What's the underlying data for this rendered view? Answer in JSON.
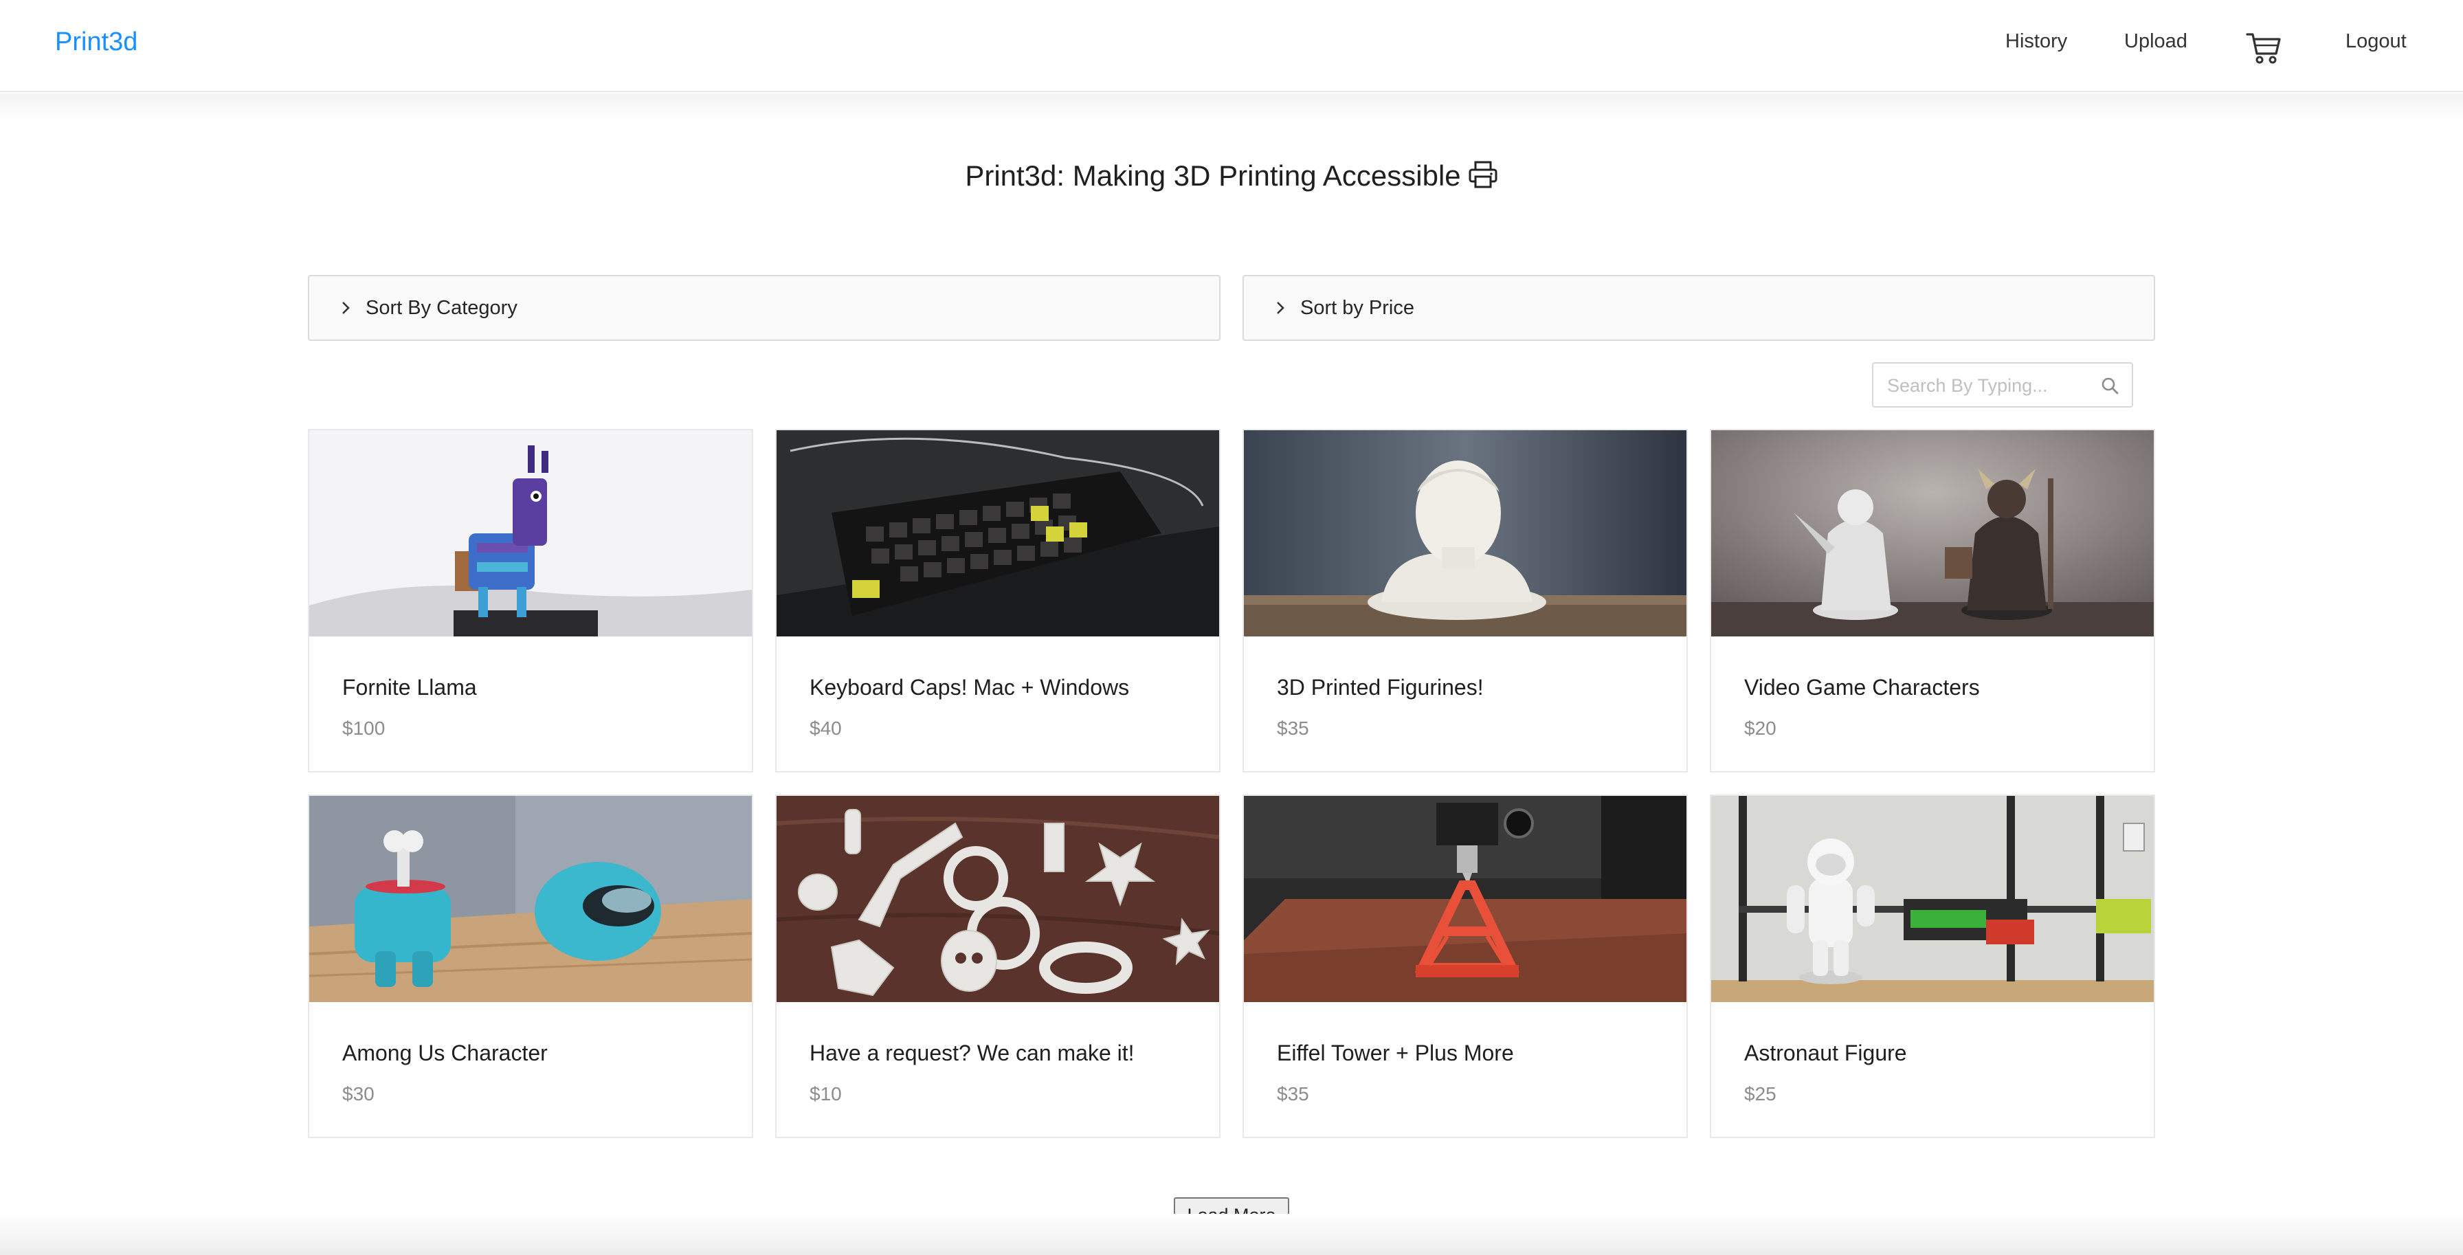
{
  "header": {
    "brand": "Print3d",
    "nav": {
      "history": "History",
      "upload": "Upload",
      "logout": "Logout"
    },
    "cart_icon": "cart-icon"
  },
  "page": {
    "title": "Print3d: Making 3D Printing Accessible",
    "title_icon": "printer-icon"
  },
  "filters": {
    "category_label": "Sort By Category",
    "price_label": "Sort by Price"
  },
  "search": {
    "placeholder": "Search By Typing...",
    "value": ""
  },
  "products": [
    {
      "name": "Fornite Llama",
      "price": "$100"
    },
    {
      "name": "Keyboard Caps! Mac + Windows",
      "price": "$40"
    },
    {
      "name": "3D Printed Figurines!",
      "price": "$35"
    },
    {
      "name": "Video Game Characters",
      "price": "$20"
    },
    {
      "name": "Among Us Character",
      "price": "$30"
    },
    {
      "name": "Have a request? We can make it!",
      "price": "$10"
    },
    {
      "name": "Eiffel Tower + Plus More",
      "price": "$35"
    },
    {
      "name": "Astronaut Figure",
      "price": "$25"
    }
  ],
  "load_more": "Load More",
  "colors": {
    "brand": "#1890ff",
    "border": "#d9d9d9",
    "price": "#8c8c8c"
  }
}
